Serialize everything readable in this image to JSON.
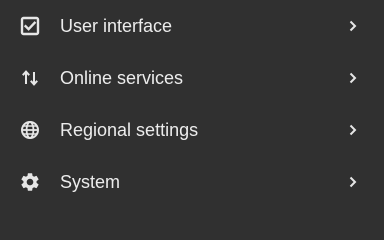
{
  "menu": {
    "items": [
      {
        "label": "User interface",
        "icon": "checkbox-icon"
      },
      {
        "label": "Online services",
        "icon": "sync-arrows-icon"
      },
      {
        "label": "Regional settings",
        "icon": "globe-icon"
      },
      {
        "label": "System",
        "icon": "gear-icon"
      }
    ]
  },
  "colors": {
    "background": "#303030",
    "text": "#ececec",
    "icon": "#e6e6e6"
  }
}
